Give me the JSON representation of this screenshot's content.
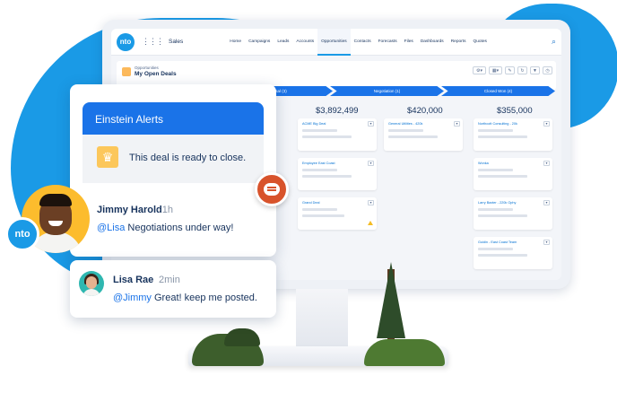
{
  "app": {
    "logo_text": "nto",
    "name": "Sales",
    "nav": [
      "Home",
      "Campaigns",
      "Leads",
      "Accounts",
      "Opportunities",
      "Contacts",
      "Forecasts",
      "Files",
      "Dashboards",
      "Reports",
      "Quotes"
    ],
    "active_nav": "Opportunities",
    "search_icon": "search-icon"
  },
  "list_header": {
    "object_label": "Opportunities",
    "view_title": "My Open Deals",
    "tools": [
      "⚙▾",
      "▦▾",
      "✎",
      "↻",
      "▼",
      "◷"
    ]
  },
  "stages": [
    {
      "label": ""
    },
    {
      "label": "Proposal (3)"
    },
    {
      "label": "Negotiation (1)"
    },
    {
      "label": "Closed Won (4)"
    }
  ],
  "columns": [
    {
      "amount": "$3,892,499",
      "cards": [
        {
          "title": "ACME Big Deal",
          "warn": false
        },
        {
          "title": "Employee East Coast",
          "warn": false
        },
        {
          "title": "Grand Deal",
          "warn": true
        }
      ]
    },
    {
      "amount": "$420,000",
      "cards": [
        {
          "title": "General Utilities - 420k",
          "warn": false
        }
      ]
    },
    {
      "amount": "$355,000",
      "cards": [
        {
          "title": "Northcott Consulting - 20k",
          "warn": false
        },
        {
          "title": "Wonka",
          "warn": false
        },
        {
          "title": "Larry Baxter - 220k Ophy",
          "warn": false
        },
        {
          "title": "Guidin - East Coast Team",
          "warn": false
        }
      ]
    }
  ],
  "alert": {
    "title": "Einstein Alerts",
    "message": "This deal is ready to close.",
    "icon": "crown-icon"
  },
  "post": {
    "author": "Jimmy Harold",
    "meta": "· 1h",
    "mention": "@Lisa",
    "text": " Negotiations under way!",
    "badge_text": "nto"
  },
  "reply": {
    "author": "Lisa Rae",
    "meta": "2min",
    "mention": "@Jimmy",
    "text": " Great! keep me posted."
  },
  "colors": {
    "brand_blue": "#1a9ae6",
    "stage_blue": "#1a73e8",
    "chat_orange": "#d8532b",
    "crown_gold": "#fcc75b"
  }
}
